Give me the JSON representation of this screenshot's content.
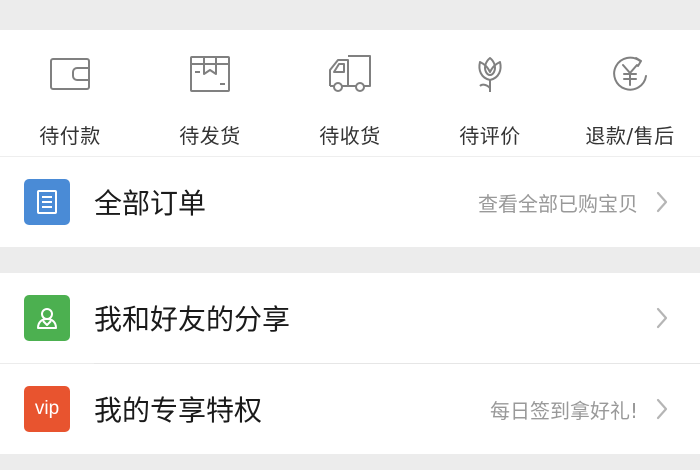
{
  "order_status": {
    "items": [
      {
        "label": "待付款",
        "icon": "wallet-icon"
      },
      {
        "label": "待发货",
        "icon": "package-box-icon"
      },
      {
        "label": "待收货",
        "icon": "delivery-truck-icon"
      },
      {
        "label": "待评价",
        "icon": "flower-review-icon"
      },
      {
        "label": "退款/售后",
        "icon": "yen-refund-icon"
      }
    ]
  },
  "all_orders": {
    "title": "全部订单",
    "hint": "查看全部已购宝贝",
    "icon": "order-list-icon",
    "icon_color": "#4a8bd6"
  },
  "friend_share": {
    "title": "我和好友的分享",
    "icon": "friends-icon",
    "icon_color": "#4cb050"
  },
  "privileges": {
    "title": "我的专享特权",
    "hint": "每日签到拿好礼!",
    "icon_text": "vip",
    "icon_color": "#e8542f"
  },
  "colors": {
    "icon_stroke": "#808080",
    "chevron": "#b5b5b5",
    "hint_text": "#999999"
  }
}
